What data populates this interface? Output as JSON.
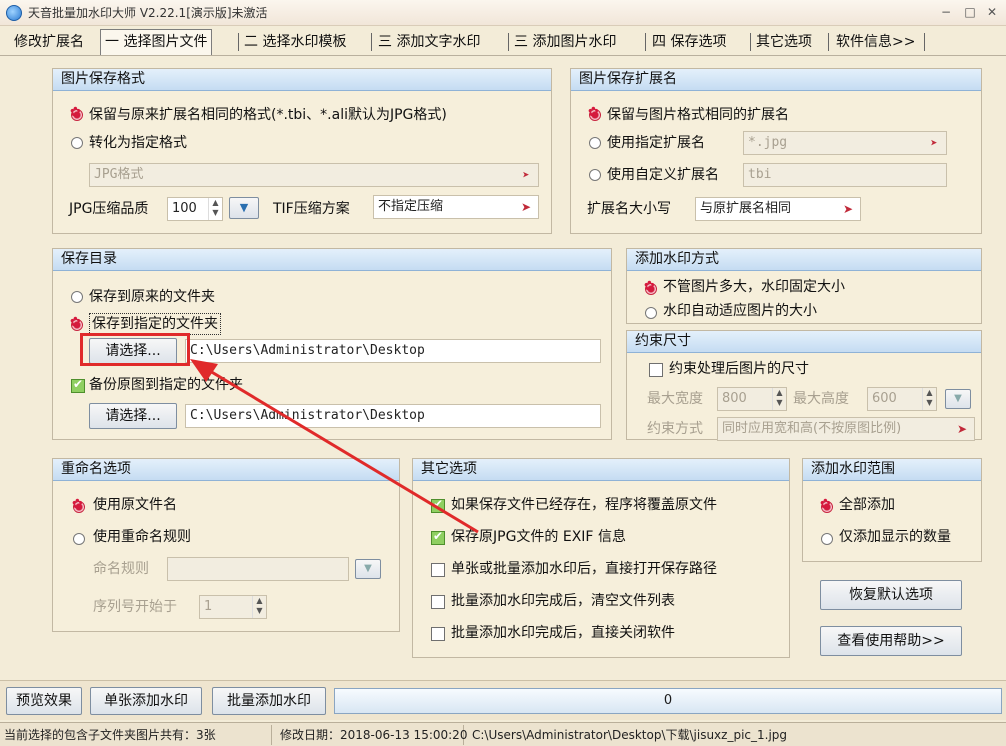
{
  "window": {
    "title": "天音批量加水印大师 V2.22.1[演示版]未激活",
    "controls": [
      "−",
      "□",
      "✕"
    ]
  },
  "tabs": [
    {
      "label": "修改扩展名"
    },
    {
      "label": "一 选择图片文件"
    },
    {
      "label": "二 选择水印模板"
    },
    {
      "label": "三 添加文字水印"
    },
    {
      "label": "三 添加图片水印"
    },
    {
      "label": "四 保存选项"
    },
    {
      "label": "其它选项"
    },
    {
      "label": "软件信息>>"
    }
  ],
  "save_format": {
    "title": "图片保存格式",
    "opt_keep": "保留与原来扩展名相同的格式(*.tbi、*.ali默认为JPG格式)",
    "opt_convert": "转化为指定格式",
    "format_value": "JPG格式",
    "jpg_quality_label": "JPG压缩品质",
    "jpg_quality_value": "100",
    "tif_label": "TIF压缩方案",
    "tif_value": "不指定压缩"
  },
  "save_ext": {
    "title": "图片保存扩展名",
    "opt_same": "保留与图片格式相同的扩展名",
    "opt_specified": "使用指定扩展名",
    "specified_value": "*.jpg",
    "opt_custom": "使用自定义扩展名",
    "custom_value": "tbi",
    "case_label": "扩展名大小写",
    "case_value": "与原扩展名相同"
  },
  "save_dir": {
    "title": "保存目录",
    "opt_original": "保存到原来的文件夹",
    "opt_specified": "保存到指定的文件夹",
    "choose_label": "请选择...",
    "path_value": "C:\\Users\\Administrator\\Desktop",
    "backup_label": "备份原图到指定的文件夹",
    "backup_choose_label": "请选择...",
    "backup_path_value": "C:\\Users\\Administrator\\Desktop"
  },
  "watermark_mode": {
    "title": "添加水印方式",
    "opt_fixed": "不管图片多大，水印固定大小",
    "opt_auto": "水印自动适应图片的大小"
  },
  "constraint": {
    "title": "约束尺寸",
    "checkbox_label": "约束处理后图片的尺寸",
    "max_width_label": "最大宽度",
    "max_width_value": "800",
    "max_height_label": "最大高度",
    "max_height_value": "600",
    "mode_label": "约束方式",
    "mode_value": "同时应用宽和高(不按原图比例)"
  },
  "rename": {
    "title": "重命名选项",
    "opt_original": "使用原文件名",
    "opt_rule": "使用重命名规则",
    "rule_label": "命名规则",
    "seq_label": "序列号开始于",
    "seq_value": "1"
  },
  "other": {
    "title": "其它选项",
    "items": [
      {
        "label": "如果保存文件已经存在，程序将覆盖原文件",
        "checked": true
      },
      {
        "label": "保存原JPG文件的 EXIF 信息",
        "checked": true
      },
      {
        "label": "单张或批量添加水印后，直接打开保存路径",
        "checked": false
      },
      {
        "label": "批量添加水印完成后，清空文件列表",
        "checked": false
      },
      {
        "label": "批量添加水印完成后，直接关闭软件",
        "checked": false
      }
    ]
  },
  "range": {
    "title": "添加水印范围",
    "opt_all": "全部添加",
    "opt_visible": "仅添加显示的数量"
  },
  "buttons": {
    "restore": "恢复默认选项",
    "help": "查看使用帮助>>",
    "preview": "预览效果",
    "single": "单张添加水印",
    "batch": "批量添加水印"
  },
  "progress": {
    "value": 0,
    "label": "0"
  },
  "status": {
    "count": "当前选择的包含子文件夹图片共有：3张",
    "modified": "修改日期：2018-06-13 15:00:20",
    "path": "C:\\Users\\Administrator\\Desktop\\下载\\jisuxz_pic_1.jpg"
  },
  "colors": {
    "panel_head": "#c5dcf2",
    "background": "#f3ecd8",
    "selected_radio": "#d11b3d",
    "annotation": "#e02a2a"
  }
}
